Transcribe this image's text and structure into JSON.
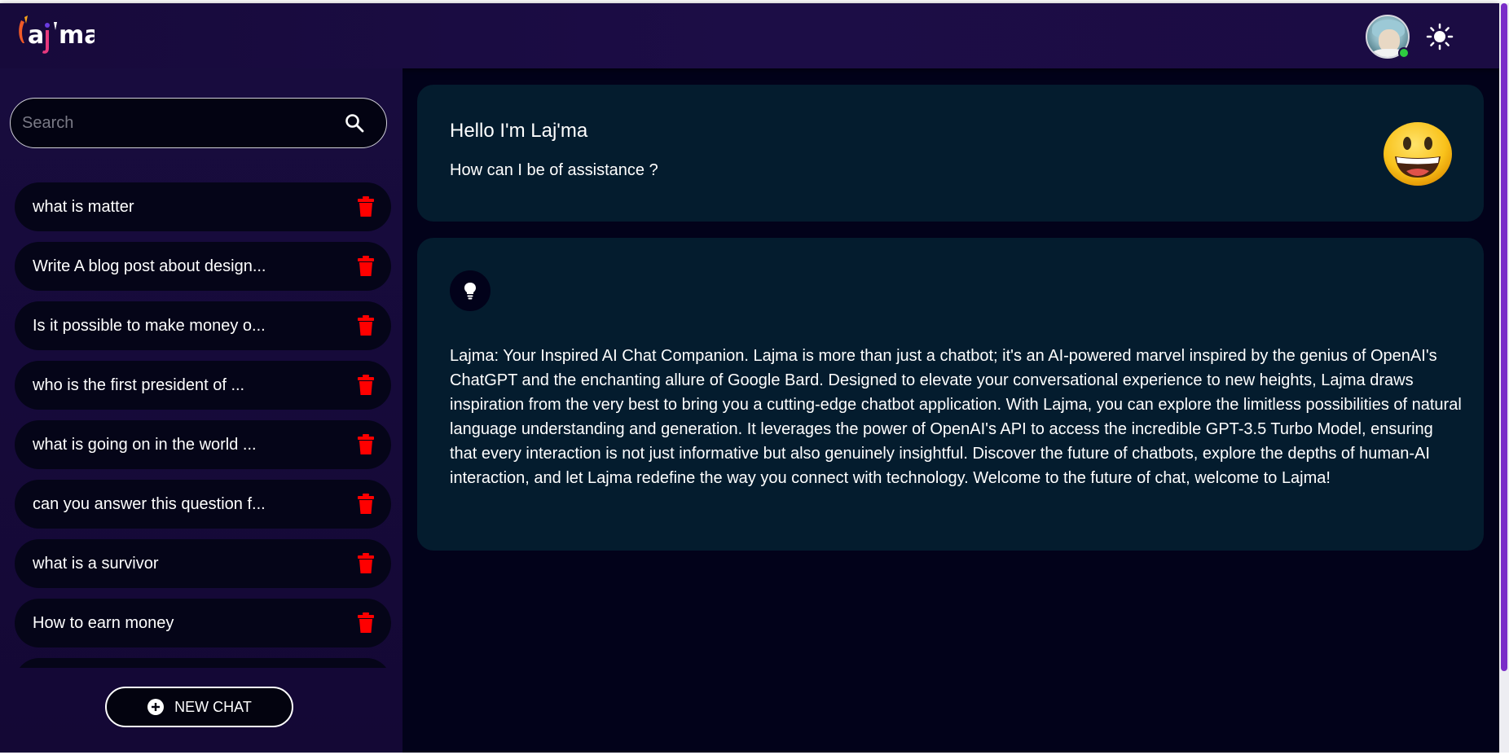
{
  "header": {
    "logo_text": "laj'ma",
    "theme_toggle_icon": "sun-icon",
    "avatar_status": "online"
  },
  "sidebar": {
    "search": {
      "placeholder": "Search",
      "value": ""
    },
    "chats": [
      {
        "label": "what is matter"
      },
      {
        "label": "Write A blog post about design..."
      },
      {
        "label": "Is it possible to make money o..."
      },
      {
        "label": "who is the first president of ..."
      },
      {
        "label": "what is going on in the world ..."
      },
      {
        "label": "can you answer this question f..."
      },
      {
        "label": "what is a survivor"
      },
      {
        "label": "How to earn money"
      }
    ],
    "new_chat_label": "NEW CHAT"
  },
  "main": {
    "greeting": {
      "title": "Hello I'm Laj'ma",
      "subtitle": "How can I be of assistance ?",
      "emoji_icon": "grinning-face-emoji"
    },
    "about": {
      "icon": "lightbulb-icon",
      "text": "Lajma: Your Inspired AI Chat Companion. Lajma is more than just a chatbot; it's an AI-powered marvel inspired by the genius of OpenAI's ChatGPT and the enchanting allure of Google Bard. Designed to elevate your conversational experience to new heights, Lajma draws inspiration from the very best to bring you a cutting-edge chatbot application. With Lajma, you can explore the limitless possibilities of natural language understanding and generation. It leverages the power of OpenAI's API to access the incredible GPT-3.5 Turbo Model, ensuring that every interaction is not just informative but also genuinely insightful. Discover the future of chatbots, explore the depths of human-AI interaction, and let Lajma redefine the way you connect with technology. Welcome to the future of chat, welcome to Lajma!"
    }
  },
  "colors": {
    "background": "#02021a",
    "card": "#041c2e",
    "sidebar": "#180c3e",
    "delete": "#ff0000",
    "scroll_thumb": "#7a2dc8"
  }
}
